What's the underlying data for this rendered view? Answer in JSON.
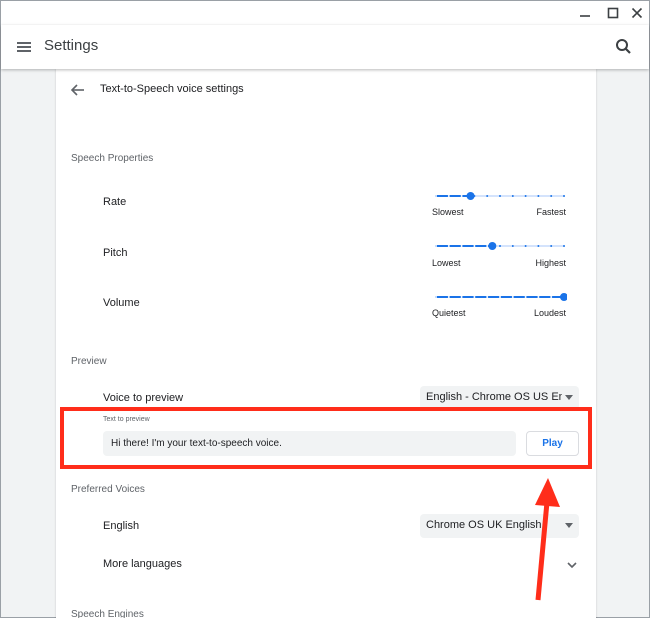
{
  "window": {
    "minimize_icon": "minimize-icon",
    "maximize_icon": "maximize-icon",
    "close_icon": "close-icon"
  },
  "header": {
    "title": "Settings",
    "menu_icon": "hamburger-menu-icon",
    "search_icon": "search-icon"
  },
  "page": {
    "title": "Text-to-Speech voice settings",
    "back_icon": "back-arrow-icon"
  },
  "speech_properties": {
    "section_title": "Speech Properties",
    "rate": {
      "label": "Rate",
      "min_label": "Slowest",
      "max_label": "Fastest",
      "level": 0.27
    },
    "pitch": {
      "label": "Pitch",
      "min_label": "Lowest",
      "max_label": "Highest",
      "level": 0.44
    },
    "volume": {
      "label": "Volume",
      "min_label": "Quietest",
      "max_label": "Loudest",
      "level": 1.0
    }
  },
  "preview": {
    "section_title": "Preview",
    "voice_label": "Voice to preview",
    "voice_value": "English - Chrome OS US English",
    "text_label": "Text to preview",
    "text_value": "Hi there! I'm your text-to-speech voice.",
    "play_label": "Play"
  },
  "preferred_voices": {
    "section_title": "Preferred Voices",
    "english_label": "English",
    "english_value": "Chrome OS UK English",
    "more_languages_label": "More languages"
  },
  "speech_engines": {
    "section_title": "Speech Engines"
  },
  "colors": {
    "accent": "#1a73e8",
    "highlight": "#ff2d1a"
  }
}
